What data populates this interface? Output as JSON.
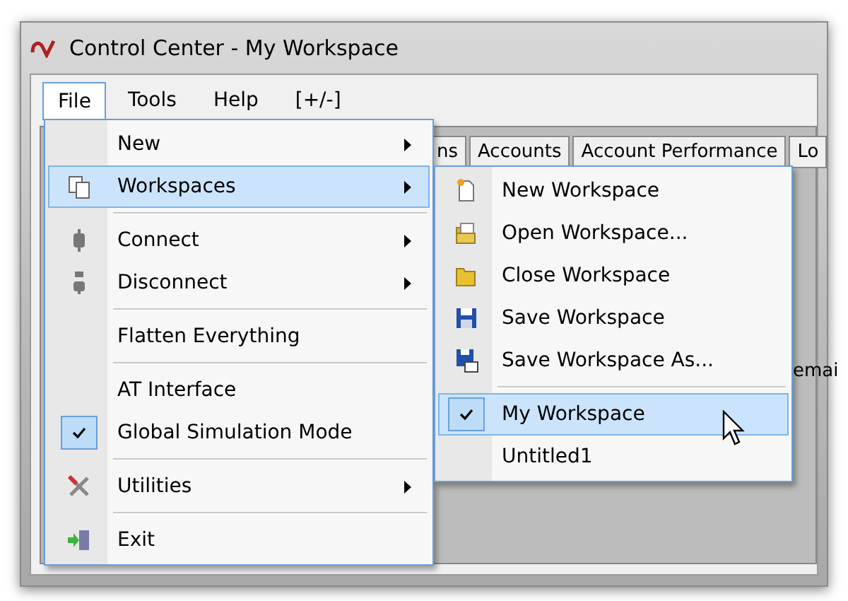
{
  "window": {
    "title": "Control Center - My Workspace"
  },
  "menu_bar": [
    {
      "label": "File",
      "selected": true
    },
    {
      "label": "Tools",
      "selected": false
    },
    {
      "label": "Help",
      "selected": false
    },
    {
      "label": "[+/-]",
      "selected": false
    }
  ],
  "tabs": [
    {
      "label": "ns"
    },
    {
      "label": "Accounts"
    },
    {
      "label": "Account Performance"
    },
    {
      "label": "Lo"
    }
  ],
  "background_text": "emai",
  "file_menu": [
    {
      "kind": "item",
      "label": "New",
      "submenu": true,
      "selected": false,
      "checked": false
    },
    {
      "kind": "item",
      "label": "Workspaces",
      "submenu": true,
      "selected": true,
      "checked": false
    },
    {
      "kind": "separator"
    },
    {
      "kind": "item",
      "label": "Connect",
      "submenu": true,
      "selected": false,
      "checked": false
    },
    {
      "kind": "item",
      "label": "Disconnect",
      "submenu": true,
      "selected": false,
      "checked": false
    },
    {
      "kind": "separator"
    },
    {
      "kind": "item",
      "label": "Flatten Everything",
      "submenu": false,
      "selected": false,
      "checked": false
    },
    {
      "kind": "separator"
    },
    {
      "kind": "item",
      "label": "AT Interface",
      "submenu": false,
      "selected": false,
      "checked": false
    },
    {
      "kind": "item",
      "label": "Global Simulation Mode",
      "submenu": false,
      "selected": false,
      "checked": true
    },
    {
      "kind": "separator"
    },
    {
      "kind": "item",
      "label": "Utilities",
      "submenu": true,
      "selected": false,
      "checked": false
    },
    {
      "kind": "separator"
    },
    {
      "kind": "item",
      "label": "Exit",
      "submenu": false,
      "selected": false,
      "checked": false
    }
  ],
  "workspaces_menu": [
    {
      "kind": "item",
      "label": "New Workspace",
      "selected": false,
      "checked": false
    },
    {
      "kind": "item",
      "label": "Open Workspace...",
      "selected": false,
      "checked": false
    },
    {
      "kind": "item",
      "label": "Close Workspace",
      "selected": false,
      "checked": false
    },
    {
      "kind": "item",
      "label": "Save Workspace",
      "selected": false,
      "checked": false
    },
    {
      "kind": "item",
      "label": "Save Workspace As...",
      "selected": false,
      "checked": false
    },
    {
      "kind": "separator"
    },
    {
      "kind": "item",
      "label": "My Workspace",
      "selected": true,
      "checked": true
    },
    {
      "kind": "item",
      "label": "Untitled1",
      "selected": false,
      "checked": false
    }
  ]
}
